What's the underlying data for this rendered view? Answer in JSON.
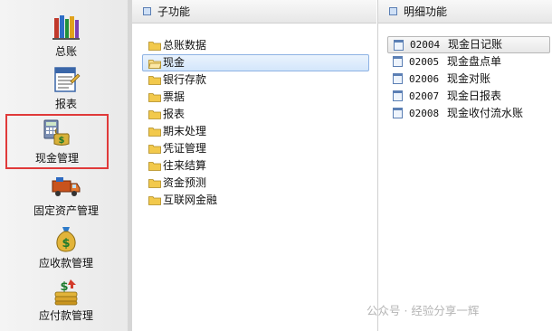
{
  "nav": {
    "items": [
      {
        "label": "总账",
        "icon": "books-icon"
      },
      {
        "label": "报表",
        "icon": "report-icon"
      },
      {
        "label": "现金管理",
        "icon": "cash-calculator-icon"
      },
      {
        "label": "固定资产管理",
        "icon": "truck-icon"
      },
      {
        "label": "应收款管理",
        "icon": "money-bag-icon"
      },
      {
        "label": "应付款管理",
        "icon": "coin-stack-icon"
      }
    ]
  },
  "sub_panel": {
    "title": "子功能",
    "items": [
      "总账数据",
      "现金",
      "银行存款",
      "票据",
      "报表",
      "期末处理",
      "凭证管理",
      "往来结算",
      "资金预测",
      "互联网金融"
    ],
    "selected_index": 1
  },
  "detail_panel": {
    "title": "明细功能",
    "items": [
      {
        "code": "02004",
        "name": "现金日记账"
      },
      {
        "code": "02005",
        "name": "现金盘点单"
      },
      {
        "code": "02006",
        "name": "现金对账"
      },
      {
        "code": "02007",
        "name": "现金日报表"
      },
      {
        "code": "02008",
        "name": "现金收付流水账"
      }
    ],
    "selected_index": 0
  },
  "watermark": "公众号 · 经验分享一辉",
  "colors": {
    "selection_outline": "#e03a3a",
    "tree_selection": "#d3e6fb"
  }
}
